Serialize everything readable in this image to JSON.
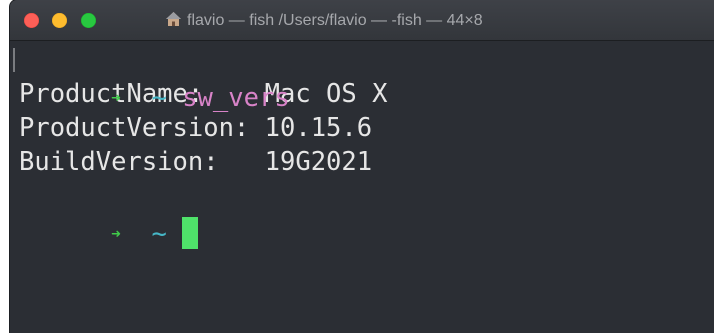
{
  "window": {
    "title": "flavio — fish /Users/flavio — -fish — 44×8"
  },
  "terminal": {
    "prompt_tilde": "~",
    "command": "sw_vers",
    "output": [
      {
        "key": "ProductName:    ",
        "value": "Mac OS X"
      },
      {
        "key": "ProductVersion: ",
        "value": "10.15.6"
      },
      {
        "key": "BuildVersion:   ",
        "value": "19G2021"
      }
    ]
  },
  "colors": {
    "background": "#2b2e34",
    "prompt_arrow": "#40cc4a",
    "prompt_tilde": "#46b7c7",
    "command": "#d883c8",
    "cursor": "#4fe26a"
  },
  "icons": [
    "home-icon",
    "prompt-arrow-icon"
  ]
}
